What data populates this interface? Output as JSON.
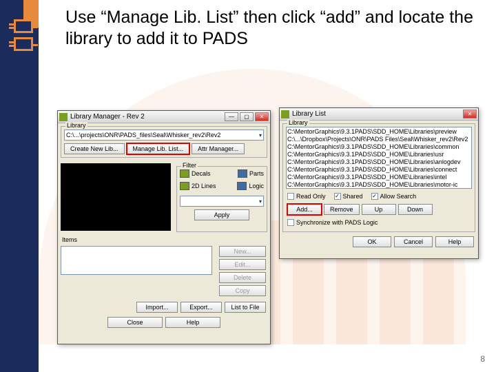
{
  "slide": {
    "title": "Use “Manage Lib. List” then click “add” and locate the library to add it to PADS",
    "page": "8"
  },
  "lm": {
    "title": "Library Manager - Rev 2",
    "lib_group": "Library",
    "lib_path": "C:\\...\\projects\\ONR\\PADS_files\\Seal\\Whisker_rev2\\Rev2",
    "create_new": "Create New Lib...",
    "manage": "Manage Lib. List...",
    "attr_mgr": "Attr Manager...",
    "filter_group": "Filter",
    "f_decals": "Decals",
    "f_parts": "Parts",
    "f_lines": "2D Lines",
    "f_logic": "Logic",
    "apply": "Apply",
    "items_group": "Items",
    "new": "New...",
    "edit": "Edit...",
    "delete": "Delete",
    "copy": "Copy",
    "import": "Import...",
    "export": "Export...",
    "list2file": "List to File",
    "close": "Close",
    "help": "Help"
  },
  "ll": {
    "title": "Library List",
    "lib_group": "Library",
    "paths": [
      "C:\\MentorGraphics\\9.3.1PADS\\SDD_HOME\\Libraries\\preview",
      "C:\\...\\Dropbox\\Projects\\ONR\\PADS Files\\Seal\\Whisker_rev2\\Rev2",
      "C:\\MentorGraphics\\9.3.1PADS\\SDD_HOME\\Libraries\\common",
      "C:\\MentorGraphics\\9.3.1PADS\\SDD_HOME\\Libraries\\usr",
      "C:\\MentorGraphics\\9.3.1PADS\\SDD_HOME\\Libraries\\anlogdev",
      "C:\\MentorGraphics\\9.3.1PADS\\SDD_HOME\\Libraries\\connect",
      "C:\\MentorGraphics\\9.3.1PADS\\SDD_HOME\\Libraries\\intel",
      "C:\\MentorGraphics\\9.3.1PADS\\SDD_HOME\\Libraries\\motor-ic"
    ],
    "readonly": "Read Only",
    "shared": "Shared",
    "allow_search": "Allow Search",
    "add": "Add...",
    "remove": "Remove",
    "up": "Up",
    "down": "Down",
    "sync": "Synchronize with PADS Logic",
    "ok": "OK",
    "cancel": "Cancel",
    "help": "Help"
  }
}
